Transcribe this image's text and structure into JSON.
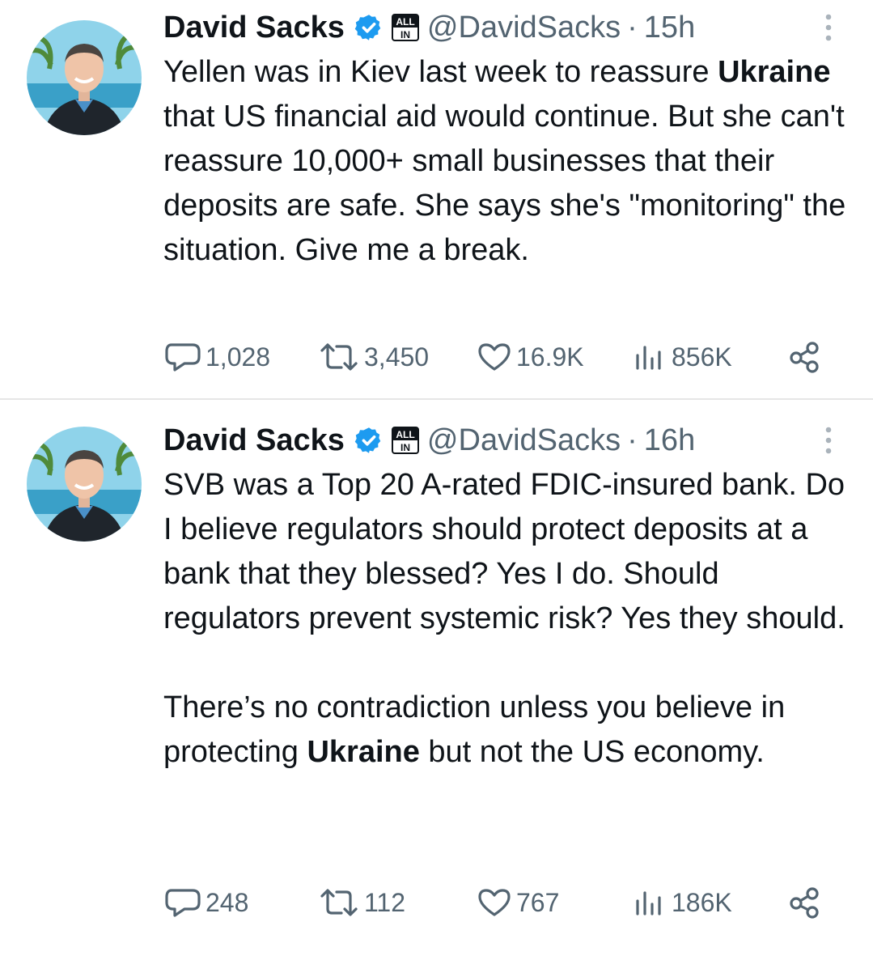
{
  "tweets": [
    {
      "author": {
        "name": "David Sacks",
        "handle": "@DavidSacks",
        "verified_icon": "verified-badge-icon",
        "affiliation_icon": "all-in-logo-icon",
        "affiliation_text": "ALL IN",
        "avatar": "avatar-image"
      },
      "separator": "·",
      "time": "15h",
      "text": {
        "p1_a": "Yellen was in Kiev last week to reassure ",
        "p1_b": "Ukraine",
        "p1_c": " that US financial aid would continue. But she can't reassure 10,000+ small businesses that their deposits are safe. She says she's \"monitoring\" the situation. Give me a break."
      },
      "stats": {
        "replies": "1,028",
        "retweets": "3,450",
        "likes": "16.9K",
        "views": "856K"
      }
    },
    {
      "author": {
        "name": "David Sacks",
        "handle": "@DavidSacks",
        "verified_icon": "verified-badge-icon",
        "affiliation_icon": "all-in-logo-icon",
        "affiliation_text": "ALL IN",
        "avatar": "avatar-image"
      },
      "separator": "·",
      "time": "16h",
      "text": {
        "p1": "SVB was a Top 20 A-rated FDIC-insured bank. Do I believe regulators should protect deposits at a bank that they blessed? Yes I do. Should regulators prevent systemic risk? Yes they should.",
        "p2_a": "There’s no contradiction unless you believe in protecting ",
        "p2_b": "Ukraine",
        "p2_c": " but not the US economy."
      },
      "stats": {
        "replies": "248",
        "retweets": "112",
        "likes": "767",
        "views": "186K"
      }
    }
  ],
  "colors": {
    "text": "#0f1419",
    "secondary": "#536471",
    "verified": "#1d9bf0",
    "divider": "#e6e6e6"
  },
  "icons": {
    "reply": "reply-bubble-icon",
    "retweet": "retweet-icon",
    "like": "heart-icon",
    "views": "views-bar-chart-icon",
    "share": "share-icon",
    "more": "more-vertical-icon"
  }
}
